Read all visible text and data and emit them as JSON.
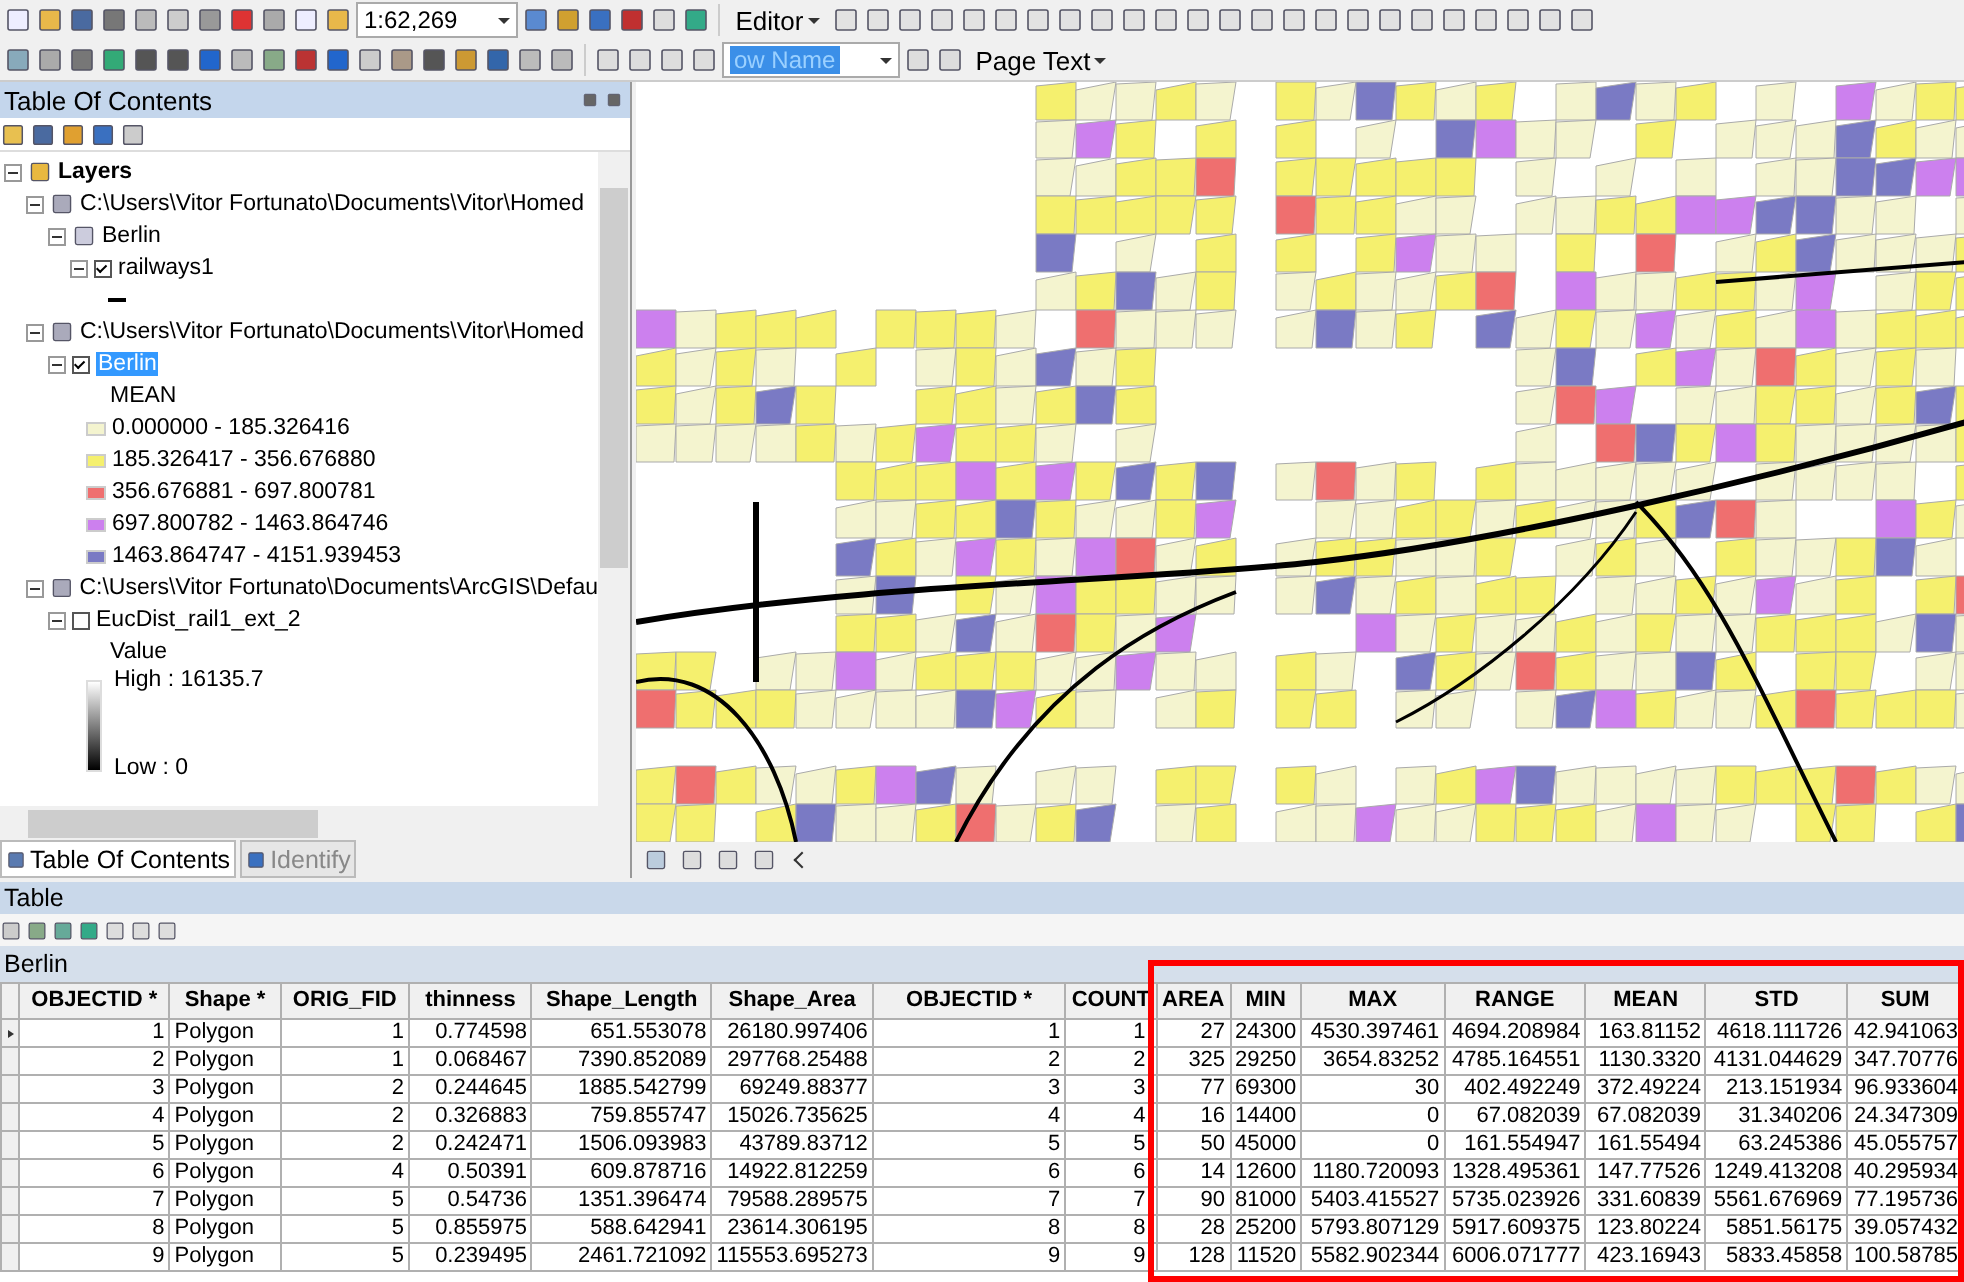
{
  "toolbar": {
    "scale": "1:62,269",
    "editor_menu": "Editor",
    "layer_dropdown": "ow Name",
    "page_text_menu": "Page Text"
  },
  "toc": {
    "title": "Table Of Contents",
    "tree": [
      {
        "kind": "frame",
        "label": "Layers",
        "expanded": true,
        "selected": false,
        "children": [
          {
            "kind": "path",
            "label": "C:\\Users\\Vitor Fortunato\\Documents\\Vitor\\Homed",
            "expanded": true,
            "selected": false,
            "children": [
              {
                "kind": "group",
                "label": "Berlin",
                "expanded": true,
                "selected": false,
                "children": [
                  {
                    "kind": "layer",
                    "label": "railways1",
                    "expanded": true,
                    "checked": true,
                    "selected": false,
                    "legend": {
                      "kind": "line"
                    }
                  }
                ]
              }
            ]
          },
          {
            "kind": "path",
            "label": "C:\\Users\\Vitor Fortunato\\Documents\\Vitor\\Homed",
            "expanded": true,
            "selected": false,
            "children": [
              {
                "kind": "layer",
                "label": "Berlin",
                "expanded": true,
                "checked": true,
                "selected": true,
                "legend": {
                  "kind": "classes",
                  "heading": "MEAN",
                  "classes": [
                    {
                      "label": "0.000000 - 185.326416",
                      "color": "#f4f4cf"
                    },
                    {
                      "label": "185.326417 - 356.676880",
                      "color": "#f5f06e"
                    },
                    {
                      "label": "356.676881 - 697.800781",
                      "color": "#ef6f6f"
                    },
                    {
                      "label": "697.800782 - 1463.864746",
                      "color": "#cc80ee"
                    },
                    {
                      "label": "1463.864747 - 4151.939453",
                      "color": "#7a7ac4"
                    }
                  ]
                }
              }
            ]
          },
          {
            "kind": "path",
            "label": "C:\\Users\\Vitor Fortunato\\Documents\\ArcGIS\\Defau",
            "expanded": true,
            "selected": false,
            "children": [
              {
                "kind": "layer",
                "label": "EucDist_rail1_ext_2",
                "expanded": true,
                "checked": false,
                "selected": false,
                "legend": {
                  "kind": "ramp",
                  "heading": "Value",
                  "high": "High : 16135.7",
                  "low": "Low : 0"
                }
              }
            ]
          }
        ]
      }
    ],
    "tabs": [
      {
        "label": "Table Of Contents",
        "selected": true
      },
      {
        "label": "Identify",
        "selected": false
      }
    ]
  },
  "table": {
    "title": "Table",
    "tab": "Berlin",
    "columns": [
      "OBJECTID *",
      "Shape *",
      "ORIG_FID",
      "thinness",
      "Shape_Length",
      "Shape_Area",
      "OBJECTID *",
      "COUNT",
      "AREA",
      "MIN",
      "MAX",
      "RANGE",
      "MEAN",
      "STD",
      "SUM"
    ],
    "rows": [
      {
        "current": true,
        "cells": [
          "1",
          "Polygon",
          "1",
          "0.774598",
          "651.553078",
          "26180.997406",
          "1",
          "1",
          "27",
          "24300",
          "4530.397461",
          "4694.208984",
          "163.81152",
          "4618.111726",
          "42.941063"
        ]
      },
      {
        "current": false,
        "cells": [
          "2",
          "Polygon",
          "1",
          "0.068467",
          "7390.852089",
          "297768.25488",
          "2",
          "2",
          "325",
          "29250",
          "3654.83252",
          "4785.164551",
          "1130.3320",
          "4131.044629",
          "347.70776"
        ]
      },
      {
        "current": false,
        "cells": [
          "3",
          "Polygon",
          "2",
          "0.244645",
          "1885.542799",
          "69249.88377",
          "3",
          "3",
          "77",
          "69300",
          "30",
          "402.492249",
          "372.49224",
          "213.151934",
          "96.933604"
        ]
      },
      {
        "current": false,
        "cells": [
          "4",
          "Polygon",
          "2",
          "0.326883",
          "759.855747",
          "15026.735625",
          "4",
          "4",
          "16",
          "14400",
          "0",
          "67.082039",
          "67.082039",
          "31.340206",
          "24.347309"
        ]
      },
      {
        "current": false,
        "cells": [
          "5",
          "Polygon",
          "2",
          "0.242471",
          "1506.093983",
          "43789.83712",
          "5",
          "5",
          "50",
          "45000",
          "0",
          "161.554947",
          "161.55494",
          "63.245386",
          "45.055757"
        ]
      },
      {
        "current": false,
        "cells": [
          "6",
          "Polygon",
          "4",
          "0.50391",
          "609.878716",
          "14922.812259",
          "6",
          "6",
          "14",
          "12600",
          "1180.720093",
          "1328.495361",
          "147.77526",
          "1249.413208",
          "40.295934"
        ]
      },
      {
        "current": false,
        "cells": [
          "7",
          "Polygon",
          "5",
          "0.54736",
          "1351.396474",
          "79588.289575",
          "7",
          "7",
          "90",
          "81000",
          "5403.415527",
          "5735.023926",
          "331.60839",
          "5561.676969",
          "77.195736"
        ]
      },
      {
        "current": false,
        "cells": [
          "8",
          "Polygon",
          "5",
          "0.855975",
          "588.642941",
          "23614.306195",
          "8",
          "8",
          "28",
          "25200",
          "5793.807129",
          "5917.609375",
          "123.80224",
          "5851.56175",
          "39.057432"
        ]
      },
      {
        "current": false,
        "cells": [
          "9",
          "Polygon",
          "5",
          "0.239495",
          "2461.721092",
          "115553.695273",
          "9",
          "9",
          "128",
          "11520",
          "5582.902344",
          "6006.071777",
          "423.16943",
          "5833.45858",
          "100.58785"
        ]
      }
    ]
  }
}
